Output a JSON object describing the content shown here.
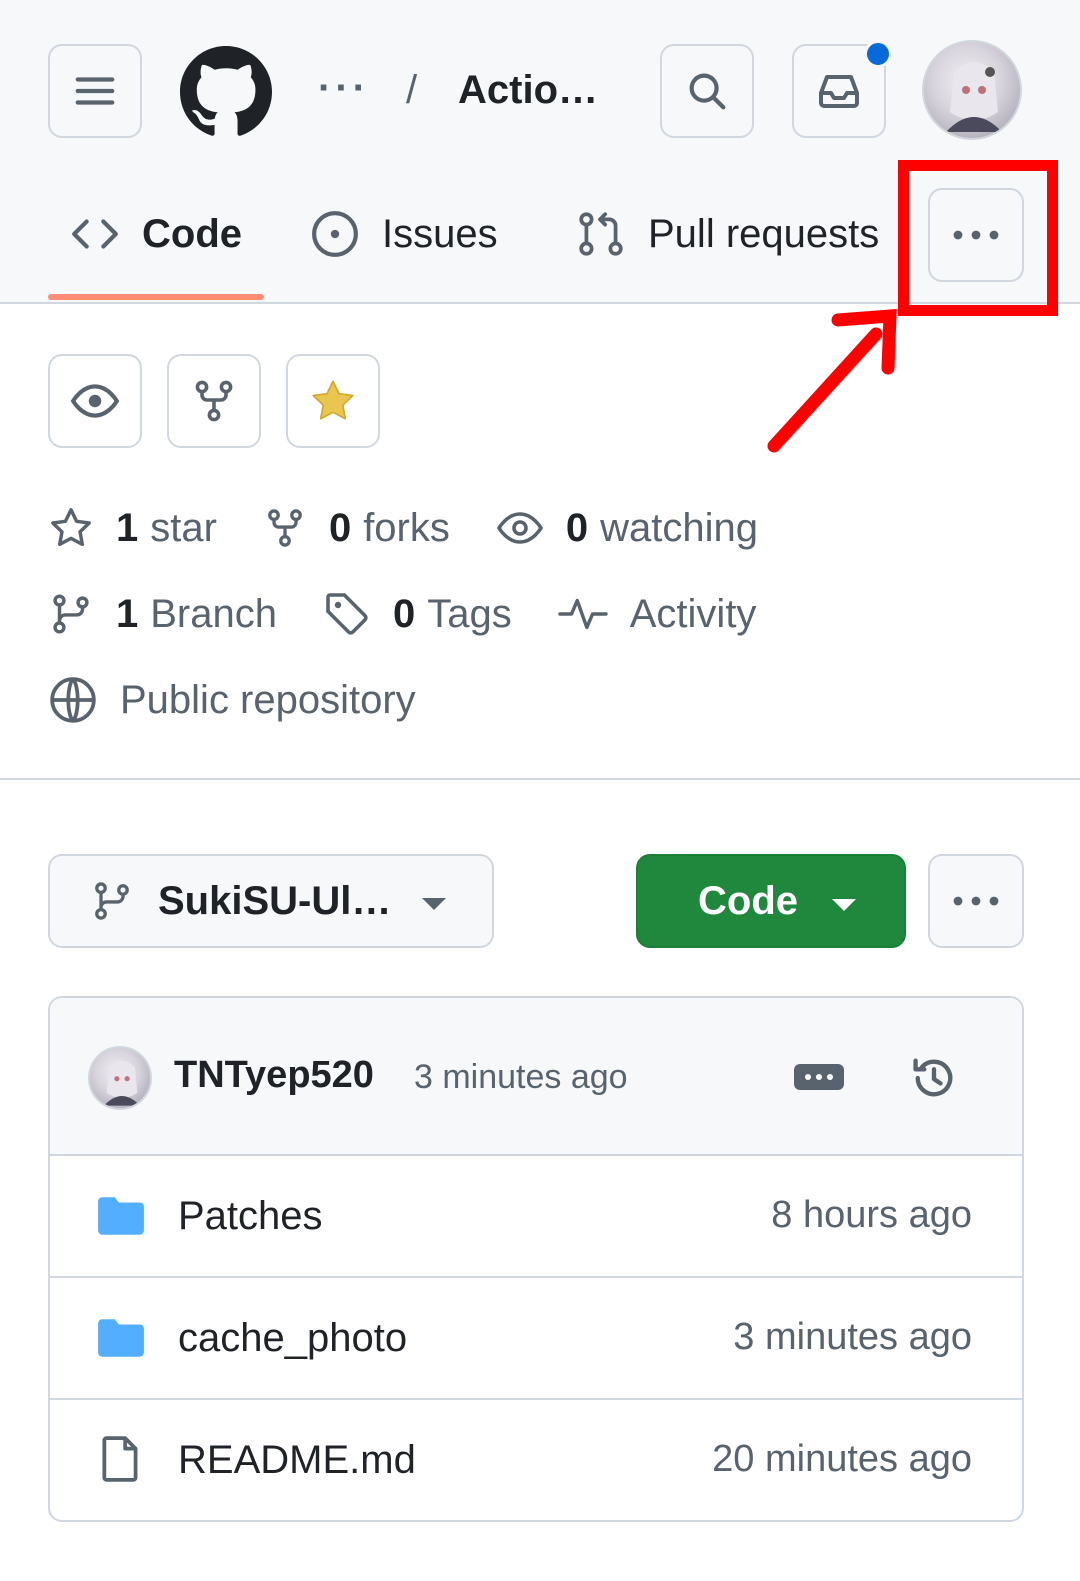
{
  "topbar": {
    "breadcrumb_ellipsis": "···",
    "breadcrumb_separator": "/",
    "repo_name": "Actio…",
    "notification_dot_color": "#0969da"
  },
  "tabs": [
    {
      "label": "Code",
      "icon": "code-icon",
      "selected": true
    },
    {
      "label": "Issues",
      "icon": "issue-opened-icon",
      "selected": false
    },
    {
      "label": "Pull requests",
      "icon": "git-pull-request-icon",
      "selected": false
    }
  ],
  "repo_actions": [
    {
      "icon": "eye-icon",
      "name": "watch"
    },
    {
      "icon": "repo-forked-icon",
      "name": "fork"
    },
    {
      "icon": "star-fill-icon",
      "name": "star",
      "icon_color": "#eac54f"
    }
  ],
  "stats": {
    "stars_count": "1",
    "stars_label": "star",
    "forks_count": "0",
    "forks_label": "forks",
    "watching_count": "0",
    "watching_label": "watching",
    "branch_count": "1",
    "branch_label": "Branch",
    "tags_count": "0",
    "tags_label": "Tags",
    "activity_label": "Activity",
    "visibility_label": "Public repository"
  },
  "branch_selector": {
    "value": "SukiSU-Ul…"
  },
  "code_button": {
    "label": "Code",
    "color": "#1f883d"
  },
  "latest_commit": {
    "author": "TNTyep520",
    "time": "3 minutes ago"
  },
  "files": [
    {
      "name": "Patches",
      "type": "folder",
      "time": "8 hours ago"
    },
    {
      "name": "cache_photo",
      "type": "folder",
      "time": "3 minutes ago"
    },
    {
      "name": "README.md",
      "type": "file",
      "time": "20 minutes ago"
    }
  ],
  "annotation": {
    "color": "#ff0000",
    "target": "tabs-overflow-button"
  }
}
